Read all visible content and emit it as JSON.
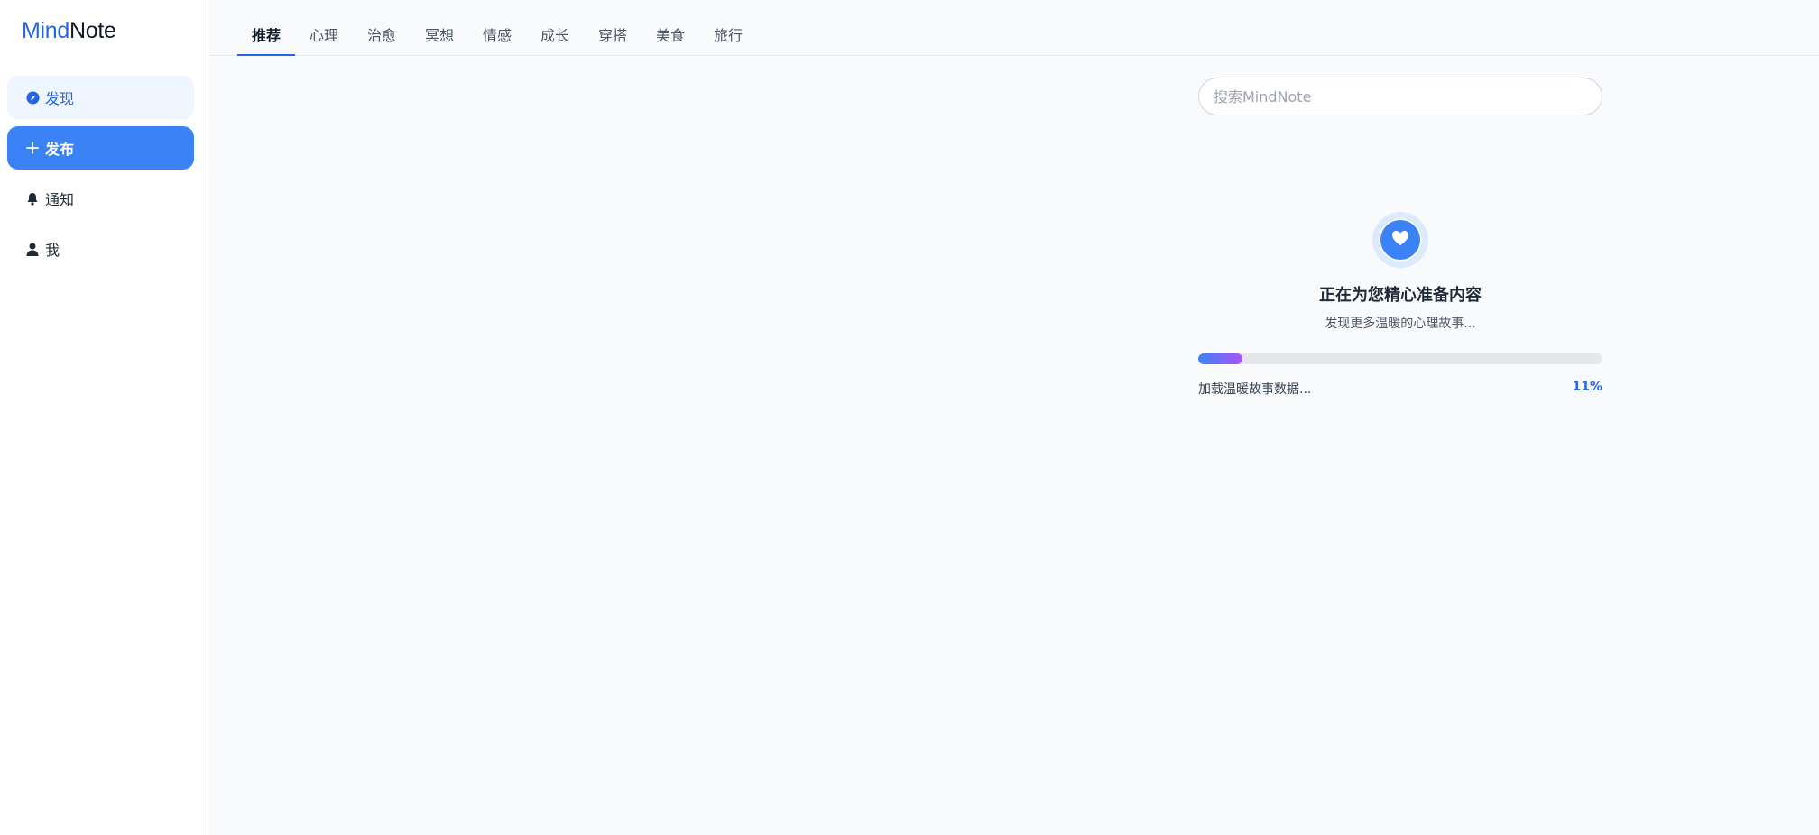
{
  "logo": {
    "part1": "Mind",
    "part2": "Note"
  },
  "sidebar": {
    "items": [
      {
        "label": "发现",
        "icon": "compass-icon"
      },
      {
        "label": "发布",
        "icon": "plus-icon"
      },
      {
        "label": "通知",
        "icon": "bell-icon"
      },
      {
        "label": "我",
        "icon": "user-icon"
      }
    ]
  },
  "tabs": [
    {
      "label": "推荐"
    },
    {
      "label": "心理"
    },
    {
      "label": "治愈"
    },
    {
      "label": "冥想"
    },
    {
      "label": "情感"
    },
    {
      "label": "成长"
    },
    {
      "label": "穿搭"
    },
    {
      "label": "美食"
    },
    {
      "label": "旅行"
    }
  ],
  "search": {
    "placeholder": "搜索MindNote",
    "value": ""
  },
  "loading": {
    "icon": "heart-icon",
    "title": "正在为您精心准备内容",
    "subtitle": "发现更多温暖的心理故事...",
    "status": "加载温暖故事数据...",
    "progress_percent": 11,
    "progress_label": "11%"
  },
  "colors": {
    "accent": "#3b82f6",
    "accent_dark": "#2563eb",
    "progress_start": "#3b82f6",
    "progress_end": "#a855f7"
  }
}
